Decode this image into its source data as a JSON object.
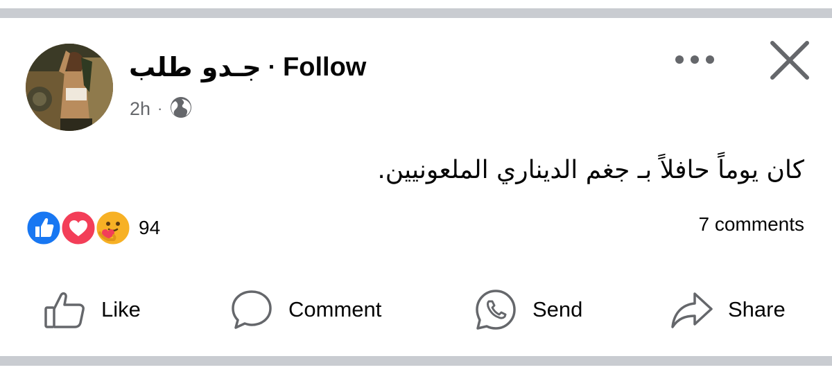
{
  "post": {
    "author_name": "جـدو طلب",
    "separator": "·",
    "follow_label": "Follow",
    "time": "2h",
    "meta_separator": "·",
    "audience_icon": "globe-icon",
    "text": "كان يوماً حافلاً بـ جغم الديناري الملعونيين."
  },
  "header_actions": {
    "more_icon": "more-horizontal-icon",
    "close_icon": "close-icon"
  },
  "engagement": {
    "reaction_icons": [
      "like-reaction-icon",
      "love-reaction-icon",
      "care-reaction-icon"
    ],
    "reaction_count": "94",
    "comments_label": "7 comments"
  },
  "actions": {
    "like": "Like",
    "comment": "Comment",
    "send": "Send",
    "share": "Share"
  },
  "colors": {
    "like_blue": "#1877f2",
    "love_red": "#f33e58",
    "care_yellow": "#f7b125",
    "icon_gray": "#65676b",
    "divider": "#c9ccd1"
  }
}
